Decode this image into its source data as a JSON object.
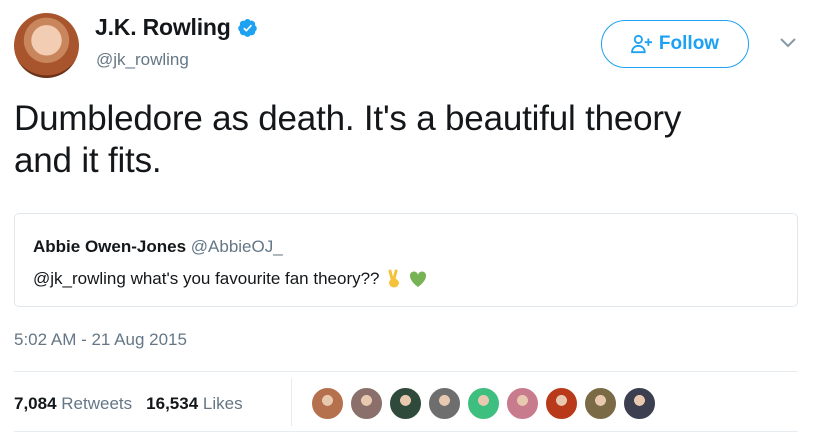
{
  "author": {
    "name": "J.K. Rowling",
    "handle": "@jk_rowling"
  },
  "follow_button": {
    "label": "Follow"
  },
  "tweet": {
    "text_line1": "Dumbledore as death. It's a beautiful theory",
    "text_line2": "and it fits."
  },
  "quoted_tweet": {
    "name": "Abbie Owen-Jones",
    "handle": "@AbbieOJ_",
    "text": "@jk_rowling what's you favourite fan theory??"
  },
  "timestamp": "5:02 AM - 21 Aug 2015",
  "stats": {
    "retweets_count": "7,084",
    "retweets_label": "Retweets",
    "likes_count": "16,534",
    "likes_label": "Likes"
  },
  "colors": {
    "accent": "#1da1f2",
    "secondary_text": "#657786",
    "primary_text": "#14171a"
  },
  "likers": [
    {
      "color": "#b5714d"
    },
    {
      "color": "#8a6f6a"
    },
    {
      "color": "#2f4a3a"
    },
    {
      "color": "#6e6e6e"
    },
    {
      "color": "#3fbf7f"
    },
    {
      "color": "#c97b8e"
    },
    {
      "color": "#b83a1a"
    },
    {
      "color": "#7a6a45"
    },
    {
      "color": "#3c3f4f"
    }
  ]
}
